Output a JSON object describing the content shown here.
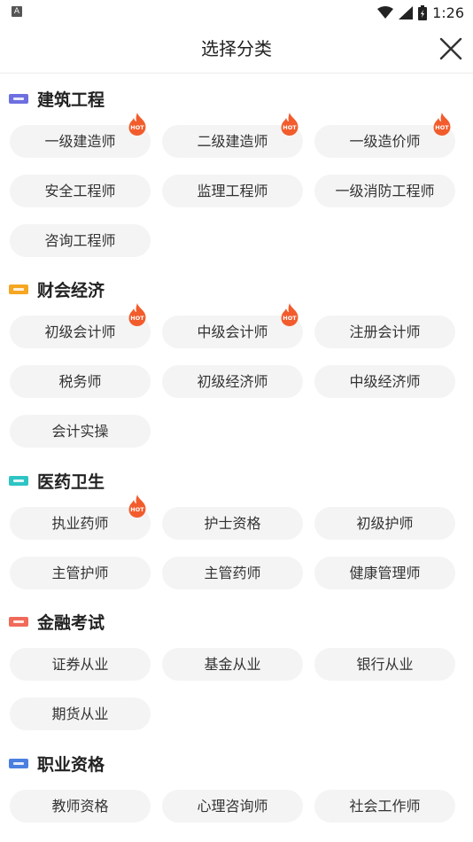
{
  "status_bar": {
    "app_badge": "A",
    "time": "1:26"
  },
  "header": {
    "title": "选择分类"
  },
  "hot_label": "HOT",
  "sections": [
    {
      "name": "建筑工程",
      "icon_color": "#6d6fe0",
      "items": [
        {
          "label": "一级建造师",
          "hot": true
        },
        {
          "label": "二级建造师",
          "hot": true
        },
        {
          "label": "一级造价师",
          "hot": true
        },
        {
          "label": "安全工程师",
          "hot": false
        },
        {
          "label": "监理工程师",
          "hot": false
        },
        {
          "label": "一级消防工程师",
          "hot": false
        },
        {
          "label": "咨询工程师",
          "hot": false
        }
      ]
    },
    {
      "name": "财会经济",
      "icon_color": "#f5a623",
      "items": [
        {
          "label": "初级会计师",
          "hot": true
        },
        {
          "label": "中级会计师",
          "hot": true
        },
        {
          "label": "注册会计师",
          "hot": false
        },
        {
          "label": "税务师",
          "hot": false
        },
        {
          "label": "初级经济师",
          "hot": false
        },
        {
          "label": "中级经济师",
          "hot": false
        },
        {
          "label": "会计实操",
          "hot": false
        }
      ]
    },
    {
      "name": "医药卫生",
      "icon_color": "#2ec4c4",
      "items": [
        {
          "label": "执业药师",
          "hot": true
        },
        {
          "label": "护士资格",
          "hot": false
        },
        {
          "label": "初级护师",
          "hot": false
        },
        {
          "label": "主管护师",
          "hot": false
        },
        {
          "label": "主管药师",
          "hot": false
        },
        {
          "label": "健康管理师",
          "hot": false
        }
      ]
    },
    {
      "name": "金融考试",
      "icon_color": "#f06a5a",
      "items": [
        {
          "label": "证券从业",
          "hot": false
        },
        {
          "label": "基金从业",
          "hot": false
        },
        {
          "label": "银行从业",
          "hot": false
        },
        {
          "label": "期货从业",
          "hot": false
        }
      ]
    },
    {
      "name": "职业资格",
      "icon_color": "#4a7fe0",
      "items": [
        {
          "label": "教师资格",
          "hot": false
        },
        {
          "label": "心理咨询师",
          "hot": false
        },
        {
          "label": "社会工作师",
          "hot": false
        }
      ]
    }
  ]
}
